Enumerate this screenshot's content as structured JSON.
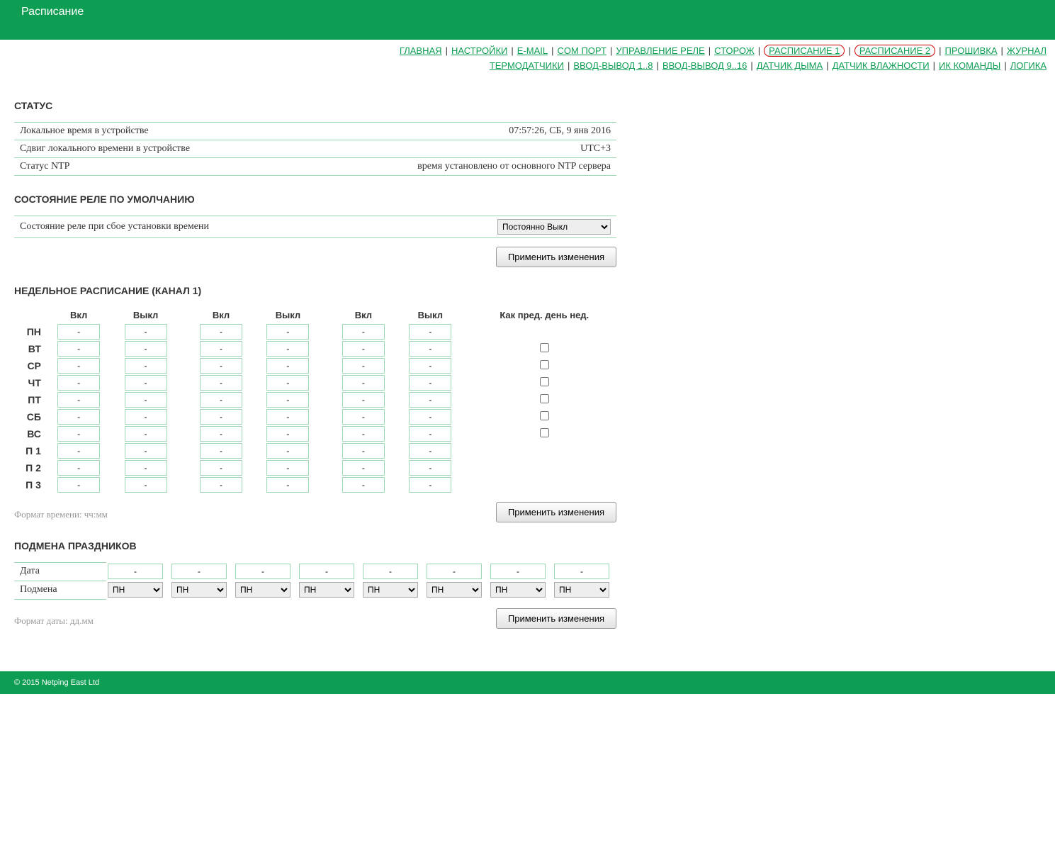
{
  "header": {
    "title": "Расписание"
  },
  "nav": {
    "row1": [
      "ГЛАВНАЯ",
      "НАСТРОЙКИ",
      "E-MAIL",
      "COM ПОРТ",
      "УПРАВЛЕНИЕ РЕЛЕ",
      "СТОРОЖ",
      "РАСПИСАНИЕ 1",
      "РАСПИСАНИЕ 2",
      "ПРОШИВКА",
      "ЖУРНАЛ"
    ],
    "row1_circled": [
      6,
      7
    ],
    "row2": [
      "ТЕРМОДАТЧИКИ",
      "ВВОД-ВЫВОД 1..8",
      "ВВОД-ВЫВОД 9..16",
      "ДАТЧИК ДЫМА",
      "ДАТЧИК ВЛАЖНОСТИ",
      "ИК КОМАНДЫ",
      "ЛОГИКА"
    ]
  },
  "sections": {
    "status": "СТАТУС",
    "default": "СОСТОЯНИЕ РЕЛЕ ПО УМОЛЧАНИЮ",
    "schedule": "НЕДЕЛЬНОЕ РАСПИСАНИЕ (КАНАЛ 1)",
    "holidays": "ПОДМЕНА ПРАЗДНИКОВ"
  },
  "status": {
    "rows": [
      {
        "label": "Локальное время в устройстве",
        "value": "07:57:26, СБ, 9 янв 2016"
      },
      {
        "label": "Сдвиг локального времени в устройстве",
        "value": "UTC+3"
      },
      {
        "label": "Статус NTP",
        "value": "время установлено от основного NTP сервера"
      }
    ]
  },
  "default": {
    "label": "Состояние реле при сбое установки времени",
    "selected": "Постоянно Выкл"
  },
  "apply_label": "Применить изменения",
  "sched": {
    "col_on": "Вкл",
    "col_off": "Выкл",
    "col_same": "Как пред. день нед.",
    "days": [
      "ПН",
      "ВТ",
      "СР",
      "ЧТ",
      "ПТ",
      "СБ",
      "ВС",
      "П 1",
      "П 2",
      "П 3"
    ],
    "cell": "-",
    "same_chk_rows": [
      1,
      2,
      3,
      4,
      5,
      6
    ],
    "hint": "Формат времени: чч:мм"
  },
  "holidays": {
    "date_label": "Дата",
    "sub_label": "Подмена",
    "date_val": "-",
    "sub_val": "ПН",
    "cols": 8,
    "hint": "Формат даты: дд.мм"
  },
  "footer": "© 2015 Netping East Ltd"
}
